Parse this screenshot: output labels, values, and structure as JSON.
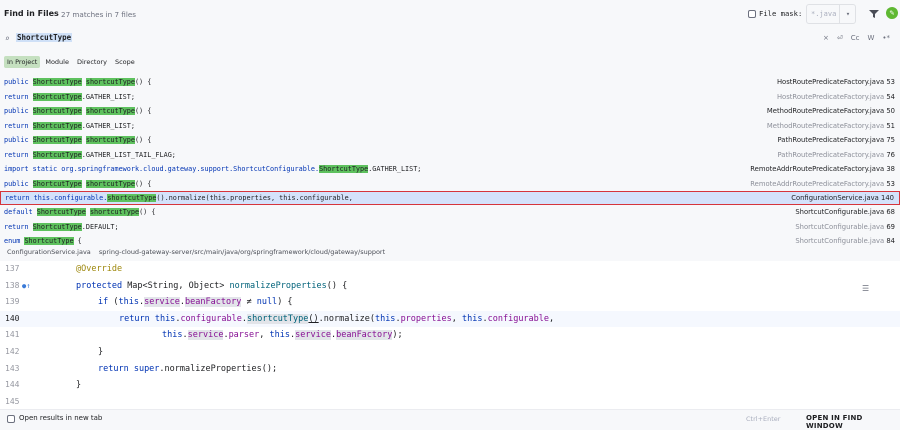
{
  "header": {
    "title": "Find in Files",
    "subtitle": "27 matches in 7 files",
    "file_mask_label": "File mask:",
    "file_mask_value": "*.java"
  },
  "search": {
    "query": "ShortcutType",
    "options": [
      "×",
      "⏎",
      "Cc",
      "W",
      "•*"
    ]
  },
  "scope": {
    "tabs": [
      "In Project",
      "Module",
      "Directory",
      "Scope"
    ]
  },
  "results": [
    {
      "pre": "public ",
      "hl": "ShortcutType",
      "mid": " ",
      "hl2": "shortcutType",
      "post": "() {",
      "file": "HostRoutePredicateFactory.java",
      "line": "53",
      "muted": false
    },
    {
      "pre": "return ",
      "hl": "ShortcutType",
      "mid": ".GATHER_LIST;",
      "hl2": "",
      "post": "",
      "file": "HostRoutePredicateFactory.java",
      "line": "54",
      "muted": true
    },
    {
      "pre": "public ",
      "hl": "ShortcutType",
      "mid": " ",
      "hl2": "shortcutType",
      "post": "() {",
      "file": "MethodRoutePredicateFactory.java",
      "line": "50",
      "muted": false
    },
    {
      "pre": "return ",
      "hl": "ShortcutType",
      "mid": ".GATHER_LIST;",
      "hl2": "",
      "post": "",
      "file": "MethodRoutePredicateFactory.java",
      "line": "51",
      "muted": true
    },
    {
      "pre": "public ",
      "hl": "ShortcutType",
      "mid": " ",
      "hl2": "shortcutType",
      "post": "() {",
      "file": "PathRoutePredicateFactory.java",
      "line": "75",
      "muted": false
    },
    {
      "pre": "return ",
      "hl": "ShortcutType",
      "mid": ".GATHER_LIST_TAIL_FLAG;",
      "hl2": "",
      "post": "",
      "file": "PathRoutePredicateFactory.java",
      "line": "76",
      "muted": true
    },
    {
      "pre": "import static org.springframework.cloud.gateway.support.ShortcutConfigurable.",
      "hl": "ShortcutType",
      "mid": ".GATHER_LIST;",
      "hl2": "",
      "post": "",
      "file": "RemoteAddrRoutePredicateFactory.java",
      "line": "38",
      "muted": false
    },
    {
      "pre": "public ",
      "hl": "ShortcutType",
      "mid": " ",
      "hl2": "shortcutType",
      "post": "() {",
      "file": "RemoteAddrRoutePredicateFactory.java",
      "line": "53",
      "muted": true
    },
    {
      "pre": "return this.configurable.",
      "hl": "shortcutType",
      "mid": "().normalize(this.properties, this.configurable,",
      "hl2": "",
      "post": "",
      "file": "ConfigurationService.java",
      "line": "140",
      "muted": false,
      "selected": true
    },
    {
      "pre": "default ",
      "hl": "ShortcutType",
      "mid": " ",
      "hl2": "shortcutType",
      "post": "() {",
      "file": "ShortcutConfigurable.java",
      "line": "68",
      "muted": false
    },
    {
      "pre": "return ",
      "hl": "ShortcutType",
      "mid": ".DEFAULT;",
      "hl2": "",
      "post": "",
      "file": "ShortcutConfigurable.java",
      "line": "69",
      "muted": true
    },
    {
      "pre": "enum ",
      "hl": "ShortcutType",
      "mid": " {",
      "hl2": "",
      "post": "",
      "file": "ShortcutConfigurable.java",
      "line": "84",
      "muted": true
    }
  ],
  "preview": {
    "file": "ConfigurationService.java",
    "path": "spring-cloud-gateway-server/src/main/java/org/springframework/cloud/gateway/support"
  },
  "code_lines": [
    {
      "num": "137",
      "html_key": 0
    },
    {
      "num": "138",
      "html_key": 1
    },
    {
      "num": "139",
      "html_key": 2
    },
    {
      "num": "140",
      "html_key": 3
    },
    {
      "num": "141",
      "html_key": 4
    },
    {
      "num": "142",
      "html_key": 5
    },
    {
      "num": "143",
      "html_key": 6
    },
    {
      "num": "144",
      "html_key": 7
    },
    {
      "num": "145",
      "html_key": 8
    }
  ],
  "code_text": {
    "l137": "@Override",
    "l138_a": "protected ",
    "l138_b": "Map<String, Object> ",
    "l138_c": "normalizeProperties",
    "l138_d": "() {",
    "l139_a": "if ",
    "l139_b": "(",
    "l139_c": "this",
    "l139_d": ".",
    "l139_e": "service",
    "l139_f": ".",
    "l139_g": "beanFactory",
    "l139_h": " ≠ ",
    "l139_i": "null",
    "l139_j": ") {",
    "l140_a": "return ",
    "l140_b": "this",
    "l140_c": ".",
    "l140_d": "configurable",
    "l140_e": ".",
    "l140_f": "shortcutType",
    "l140_g": "()",
    "l140_h": ".normalize(",
    "l140_i": "this",
    "l140_j": ".",
    "l140_k": "properties",
    "l140_l": ", ",
    "l140_m": "this",
    "l140_n": ".",
    "l140_o": "configurable",
    "l140_p": ",",
    "l141_a": "this",
    "l141_b": ".",
    "l141_c": "service",
    "l141_d": ".",
    "l141_e": "parser",
    "l141_f": ", ",
    "l141_g": "this",
    "l141_h": ".",
    "l141_i": "service",
    "l141_j": ".",
    "l141_k": "beanFactory",
    "l141_l": ");",
    "l142": "}",
    "l143_a": "return ",
    "l143_b": "super",
    "l143_c": ".normalizeProperties();",
    "l144": "}"
  },
  "footer": {
    "open_new_tab": "Open results in new tab",
    "shortcut": "Ctrl+Enter",
    "open_button": "OPEN IN FIND WINDOW"
  },
  "colors": {
    "match_highlight": "#5ec15e",
    "selection_border": "#d6353c",
    "selection_bg": "#d4e2fb",
    "scope_active": "#c5e0c0",
    "keyword": "#0033b3",
    "field": "#871094"
  }
}
